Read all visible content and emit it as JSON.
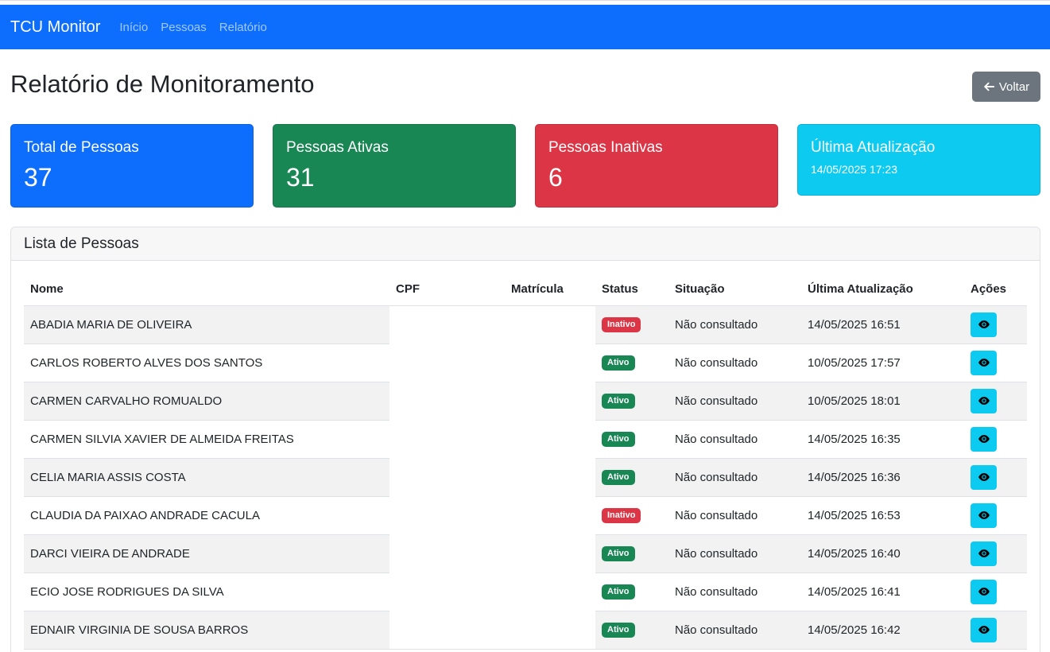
{
  "navbar": {
    "brand": "TCU Monitor",
    "links": [
      "Início",
      "Pessoas",
      "Relatório"
    ]
  },
  "page": {
    "title": "Relatório de Monitoramento",
    "back_label": "Voltar"
  },
  "cards": {
    "total": {
      "title": "Total de Pessoas",
      "value": "37"
    },
    "active": {
      "title": "Pessoas Ativas",
      "value": "31"
    },
    "inactive": {
      "title": "Pessoas Inativas",
      "value": "6"
    },
    "last_update": {
      "title": "Última Atualização",
      "value": "14/05/2025 17:23"
    }
  },
  "panel": {
    "title": "Lista de Pessoas",
    "columns": [
      "Nome",
      "CPF",
      "Matrícula",
      "Status",
      "Situação",
      "Última Atualização",
      "Ações"
    ]
  },
  "rows": [
    {
      "name": "ABADIA MARIA DE OLIVEIRA",
      "status": "Inativo",
      "situation": "Não consultado",
      "updated": "14/05/2025 16:51"
    },
    {
      "name": "CARLOS ROBERTO ALVES DOS SANTOS",
      "status": "Ativo",
      "situation": "Não consultado",
      "updated": "10/05/2025 17:57"
    },
    {
      "name": "CARMEN CARVALHO ROMUALDO",
      "status": "Ativo",
      "situation": "Não consultado",
      "updated": "10/05/2025 18:01"
    },
    {
      "name": "CARMEN SILVIA XAVIER DE ALMEIDA FREITAS",
      "status": "Ativo",
      "situation": "Não consultado",
      "updated": "14/05/2025 16:35"
    },
    {
      "name": "CELIA MARIA ASSIS COSTA",
      "status": "Ativo",
      "situation": "Não consultado",
      "updated": "14/05/2025 16:36"
    },
    {
      "name": "CLAUDIA DA PAIXAO ANDRADE CACULA",
      "status": "Inativo",
      "situation": "Não consultado",
      "updated": "14/05/2025 16:53"
    },
    {
      "name": "DARCI VIEIRA DE ANDRADE",
      "status": "Ativo",
      "situation": "Não consultado",
      "updated": "14/05/2025 16:40"
    },
    {
      "name": "ECIO JOSE RODRIGUES DA SILVA",
      "status": "Ativo",
      "situation": "Não consultado",
      "updated": "14/05/2025 16:41"
    },
    {
      "name": "EDNAIR VIRGINIA DE SOUSA BARROS",
      "status": "Ativo",
      "situation": "Não consultado",
      "updated": "14/05/2025 16:42"
    }
  ],
  "icons": {
    "back": "arrow-left-icon",
    "view": "eye-icon"
  },
  "colors": {
    "primary": "#0d6efd",
    "success": "#198754",
    "danger": "#dc3545",
    "info": "#0dcaf0",
    "secondary": "#6c757d"
  }
}
